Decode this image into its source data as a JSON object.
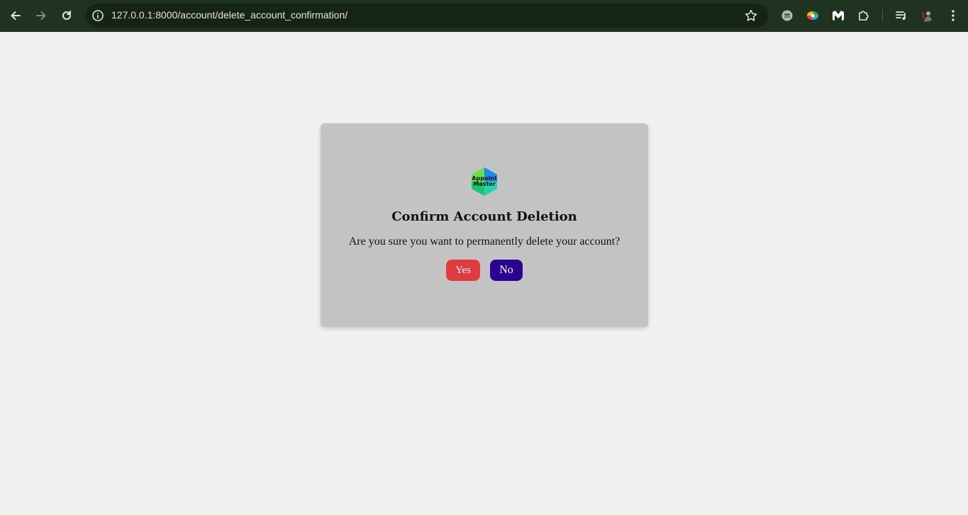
{
  "browser": {
    "url": "127.0.0.1:8000/account/delete_account_confirmation/",
    "toolbar_color": "#1f3320"
  },
  "logo": {
    "line1": "Appoint",
    "line2": "Master"
  },
  "dialog": {
    "title": "Confirm Account Deletion",
    "message": "Are you sure you want to permanently delete your account?",
    "yes_label": "Yes",
    "no_label": "No",
    "yes_color": "#e03c3f",
    "no_color": "#2c0390"
  }
}
